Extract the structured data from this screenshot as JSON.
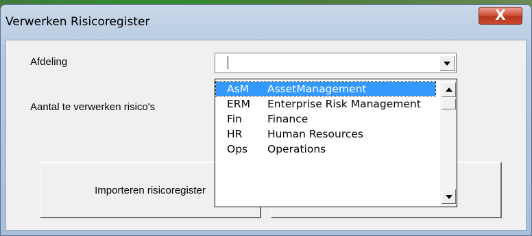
{
  "window": {
    "title": "Verwerken Risicoregister",
    "close_label": "X"
  },
  "form": {
    "afdeling_label": "Afdeling",
    "aantal_label": "Aantal te verwerken risico's",
    "afdeling_value": ""
  },
  "buttons": {
    "import_label": "Importeren risicoregister"
  },
  "dropdown": {
    "items": [
      {
        "code": "AsM",
        "name": "AssetManagement",
        "selected": true
      },
      {
        "code": "ERM",
        "name": "Enterprise Risk Management",
        "selected": false
      },
      {
        "code": "Fin",
        "name": "Finance",
        "selected": false
      },
      {
        "code": "HR",
        "name": "Human Resources",
        "selected": false
      },
      {
        "code": "Ops",
        "name": "Operations",
        "selected": false
      }
    ]
  },
  "colors": {
    "selection": "#3399ff",
    "close_button": "#c8472f",
    "client_bg": "#f0f0f0"
  }
}
